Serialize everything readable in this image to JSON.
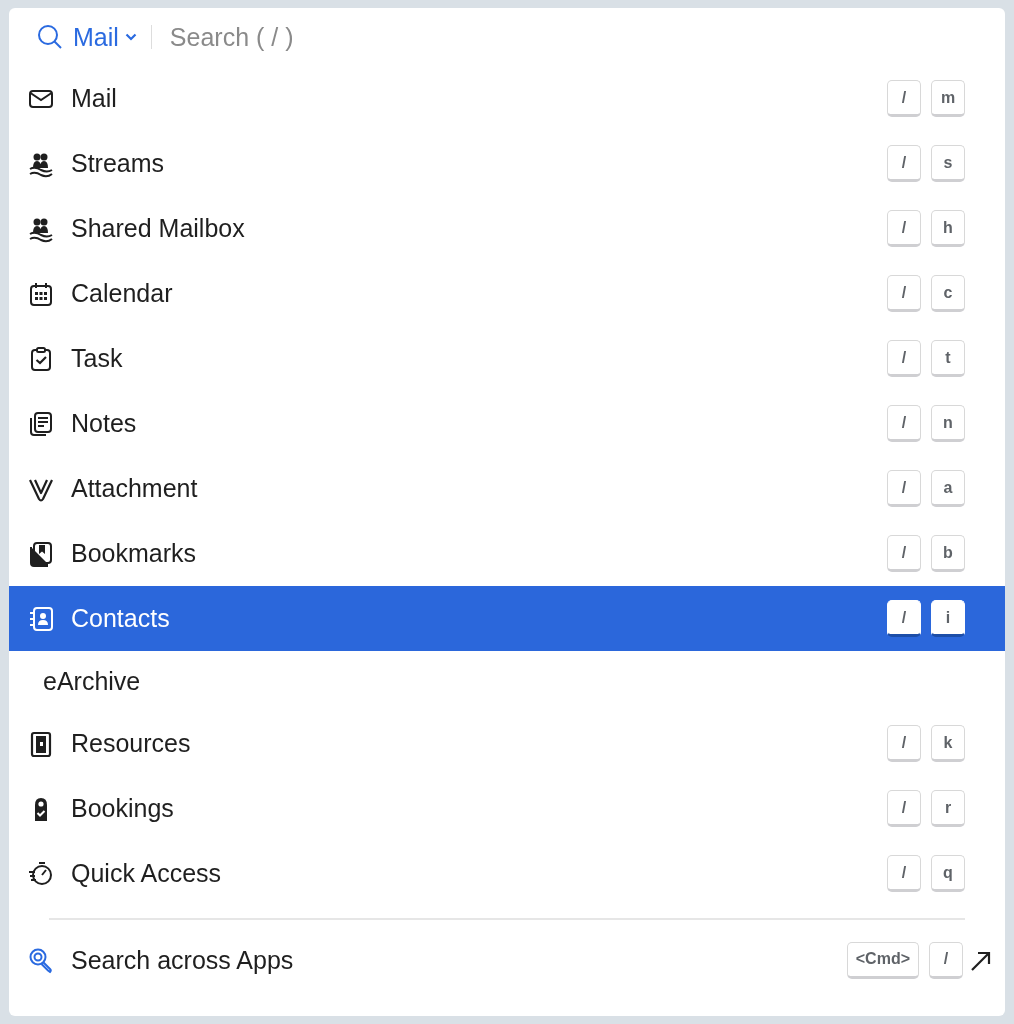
{
  "search": {
    "scope": "Mail",
    "placeholder": "Search ( / )"
  },
  "items": [
    {
      "kind": "app",
      "label": "Mail",
      "keys": [
        "/",
        "m"
      ],
      "selected": false
    },
    {
      "kind": "app",
      "label": "Streams",
      "keys": [
        "/",
        "s"
      ],
      "selected": false
    },
    {
      "kind": "app",
      "label": "Shared Mailbox",
      "keys": [
        "/",
        "h"
      ],
      "selected": false
    },
    {
      "kind": "app",
      "label": "Calendar",
      "keys": [
        "/",
        "c"
      ],
      "selected": false
    },
    {
      "kind": "app",
      "label": "Task",
      "keys": [
        "/",
        "t"
      ],
      "selected": false
    },
    {
      "kind": "app",
      "label": "Notes",
      "keys": [
        "/",
        "n"
      ],
      "selected": false
    },
    {
      "kind": "app",
      "label": "Attachment",
      "keys": [
        "/",
        "a"
      ],
      "selected": false
    },
    {
      "kind": "app",
      "label": "Bookmarks",
      "keys": [
        "/",
        "b"
      ],
      "selected": false
    },
    {
      "kind": "app",
      "label": "Contacts",
      "keys": [
        "/",
        "i"
      ],
      "selected": true
    },
    {
      "kind": "plain",
      "label": "eArchive",
      "selected": false
    },
    {
      "kind": "app",
      "label": "Resources",
      "keys": [
        "/",
        "k"
      ],
      "selected": false
    },
    {
      "kind": "app",
      "label": "Bookings",
      "keys": [
        "/",
        "r"
      ],
      "selected": false
    },
    {
      "kind": "app",
      "label": "Quick Access",
      "keys": [
        "/",
        "q"
      ],
      "selected": false
    }
  ],
  "footer": {
    "label": "Search across Apps",
    "keys": [
      "<Cmd>",
      "/"
    ]
  }
}
